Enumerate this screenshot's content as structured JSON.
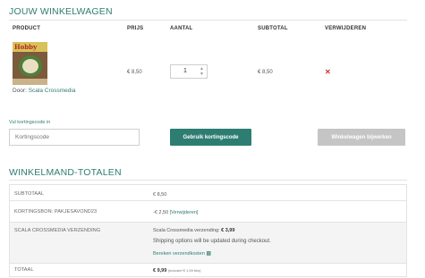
{
  "cart": {
    "title": "JOUW WINKELWAGEN",
    "columns": {
      "product": "PRODUCT",
      "price": "PRIJS",
      "quantity": "AANTAL",
      "subtotal": "SUBTOTAL",
      "remove": "VERWIJDEREN"
    },
    "item": {
      "by_label": "Door:",
      "vendor": "Scala Crossmedia",
      "price": "€ 8,50",
      "quantity": "1",
      "subtotal": "€ 8,50",
      "remove_icon": "close-icon"
    }
  },
  "coupon": {
    "label": "Vul kortingscode in",
    "placeholder": "Kortingscode",
    "apply_label": "Gebruik kortingscode",
    "update_label": "Winkelwagen bijwerken"
  },
  "totals": {
    "title": "WINKELMAND-TOTALEN",
    "subtotal_label": "SUBTOTAAL",
    "subtotal_value": "€ 8,50",
    "coupon_label": "KORTINGSBON: PAKJESAVOND23",
    "coupon_value": "-€ 2,50",
    "coupon_remove": "[Verwijderen]",
    "shipping_label": "SCALA CROSSMEDIA VERZENDING",
    "shipping_method": "Scala Crossmedia verzending:",
    "shipping_amount": "€ 3,99",
    "shipping_note": "Shipping options will be updated during checkout.",
    "shipping_calc": "Bereken verzendkosten",
    "total_label": "TOTAAL",
    "total_value": "€ 9,99",
    "total_tax": "(inclusief € 1,59 btw)"
  },
  "colors": {
    "accent": "#2e7d72",
    "remove": "#d0312d",
    "disabled_button": "#c5c5c5"
  }
}
